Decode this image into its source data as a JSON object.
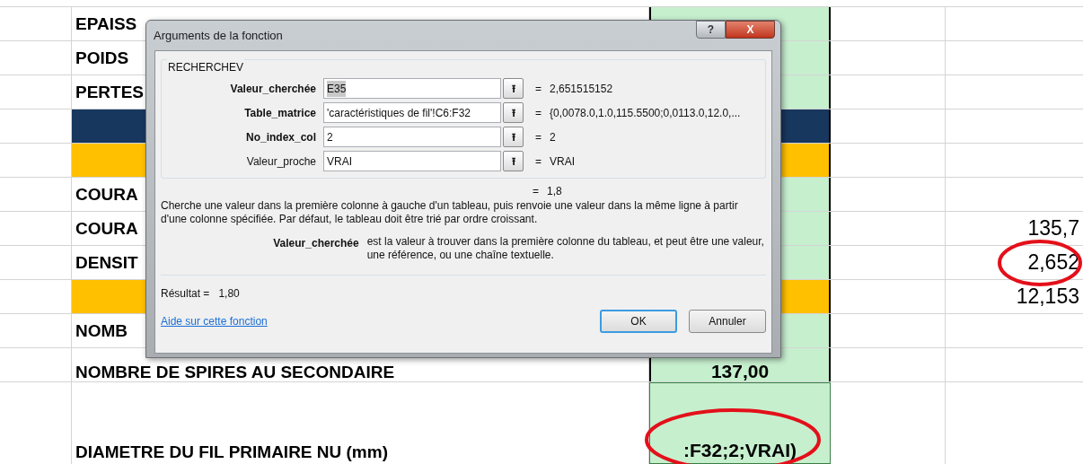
{
  "sheet": {
    "rows": [
      {
        "kind": "data",
        "label": "EPAISS"
      },
      {
        "kind": "data",
        "label": "POIDS"
      },
      {
        "kind": "data",
        "label": "PERTES"
      },
      {
        "kind": "band_dark"
      },
      {
        "kind": "band_yellow"
      },
      {
        "kind": "data",
        "label": "COURA"
      },
      {
        "kind": "data",
        "label": "COURA",
        "extra": "135,7"
      },
      {
        "kind": "data",
        "label": "DENSIT",
        "extra": "2,652",
        "circled": true
      },
      {
        "kind": "band_yellow",
        "extra": "12,153"
      },
      {
        "kind": "data",
        "label": "NOMB"
      },
      {
        "kind": "data",
        "label": "NOMBRE DE SPIRES AU SECONDAIRE",
        "value": "137,00"
      },
      {
        "kind": "tall",
        "label": "DIAMETRE DU FIL PRIMAIRE NU  (mm)",
        "value": ":F32;2;VRAI)",
        "circled": true
      }
    ]
  },
  "dialog": {
    "title": "Arguments de la fonction",
    "help_button": "?",
    "close_button": "X",
    "function": "RECHERCHEV",
    "args": [
      {
        "label": "Valeur_cherchée",
        "value": "E35",
        "result": "2,651515152",
        "required": true,
        "text_selected": true
      },
      {
        "label": "Table_matrice",
        "value": "'caractéristiques de fil'!C6:F32",
        "result": "{0,0078.0,1.0,115.5500;0,0113.0,12.0,...",
        "required": true,
        "text_selected": false
      },
      {
        "label": "No_index_col",
        "value": "2",
        "result": "2",
        "required": true,
        "text_selected": false
      },
      {
        "label": "Valeur_proche",
        "value": "VRAI",
        "result": "VRAI",
        "required": false,
        "text_selected": false
      }
    ],
    "collapse_icon": "⭱",
    "equals": "=",
    "formula_result": "1,8",
    "description": "Cherche une valeur dans la première colonne à gauche d'un tableau, puis renvoie une valeur dans la même ligne à partir d'une colonne spécifiée. Par défaut, le tableau doit être trié par ordre croissant.",
    "arg_help_label": "Valeur_cherchée",
    "arg_help_text": "est la valeur à trouver dans la première colonne du tableau, et peut être une valeur, une référence, ou une chaîne textuelle.",
    "result_label": "Résultat =",
    "result_value": "1,80",
    "help_link": "Aide sur cette fonction",
    "buttons": [
      {
        "label": "OK",
        "default": true
      },
      {
        "label": "Annuler",
        "default": false
      }
    ]
  }
}
